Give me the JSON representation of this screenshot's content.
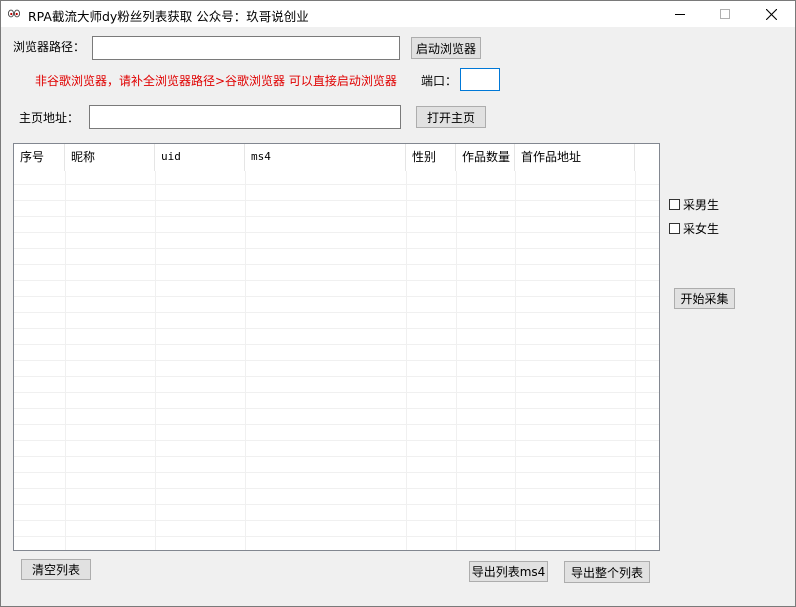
{
  "window": {
    "title": "RPA截流大师dy粉丝列表获取  公众号：玖哥说创业"
  },
  "browser": {
    "path_label": "浏览器路径：",
    "path_value": "",
    "launch_button": "启动浏览器",
    "hint": "非谷歌浏览器，请补全浏览器路径>谷歌浏览器 可以直接启动浏览器",
    "port_label": "端口：",
    "port_value": ""
  },
  "homepage": {
    "label": "主页地址：",
    "value": "",
    "open_button": "打开主页"
  },
  "table": {
    "columns": [
      "序号",
      "昵称",
      "uid",
      "ms4",
      "性别",
      "作品数量",
      "首作品地址"
    ],
    "rows": []
  },
  "options": {
    "male_label": "采男生",
    "male_checked": false,
    "female_label": "采女生",
    "female_checked": false,
    "start_button": "开始采集"
  },
  "footer": {
    "clear_button": "清空列表",
    "export_ms4_button": "导出列表ms4",
    "export_all_button": "导出整个列表"
  }
}
